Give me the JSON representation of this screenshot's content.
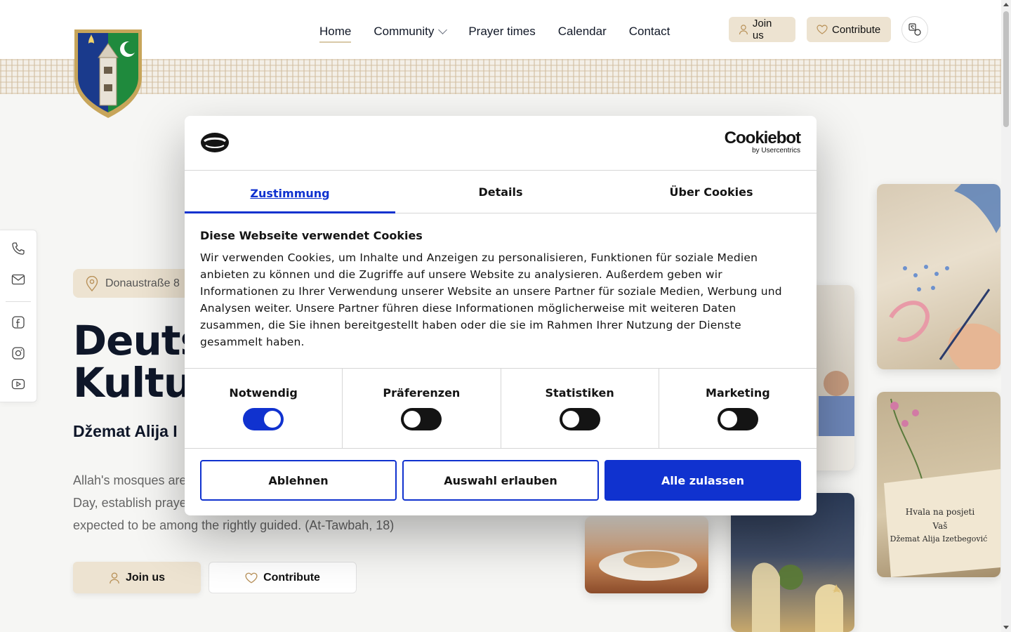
{
  "header": {
    "nav": [
      {
        "label": "Home",
        "active": true
      },
      {
        "label": "Community",
        "dropdown": true
      },
      {
        "label": "Prayer times"
      },
      {
        "label": "Calendar"
      },
      {
        "label": "Contact"
      }
    ],
    "join_label": "Join us",
    "contribute_label": "Contribute"
  },
  "hero": {
    "address": "Donaustraße 8",
    "title_line1": "Deuts",
    "title_line2": "Kultur",
    "subtitle": "Džemat Alija I",
    "quote": "Allah's mosques are ... Day, establish praye ... expected to be among the rightly guided. (At-Tawbah, 18)",
    "quote_lines": [
      "Allah's mosques are",
      "Day, establish praye",
      "expected to be among the rightly guided. (At-Tawbah, 18)"
    ],
    "join_label": "Join us",
    "contribute_label": "Contribute"
  },
  "photos": {
    "card_text_lines": [
      "Hvala na posjeti",
      "Vaš",
      "Džemat Alija Izetbegović"
    ]
  },
  "cookie": {
    "brand": "Cookiebot",
    "brand_sub": "by Usercentrics",
    "tabs": [
      "Zustimmung",
      "Details",
      "Über Cookies"
    ],
    "heading": "Diese Webseite verwendet Cookies",
    "body": "Wir verwenden Cookies, um Inhalte und Anzeigen zu personalisieren, Funktionen für soziale Medien anbieten zu können und die Zugriffe auf unsere Website zu analysieren. Außerdem geben wir Informationen zu Ihrer Verwendung unserer Website an unsere Partner für soziale Medien, Werbung und Analysen weiter. Unsere Partner führen diese Informationen möglicherweise mit weiteren Daten zusammen, die Sie ihnen bereitgestellt haben oder die sie im Rahmen Ihrer Nutzung der Dienste gesammelt haben.",
    "categories": [
      {
        "label": "Notwendig",
        "on": true
      },
      {
        "label": "Präferenzen",
        "on": false
      },
      {
        "label": "Statistiken",
        "on": false
      },
      {
        "label": "Marketing",
        "on": false
      }
    ],
    "buttons": {
      "deny": "Ablehnen",
      "selection": "Auswahl erlauben",
      "accept": "Alle zulassen"
    }
  },
  "colors": {
    "accent": "#1032cf",
    "beige": "#ede3d1",
    "navy": "#0f1729"
  }
}
